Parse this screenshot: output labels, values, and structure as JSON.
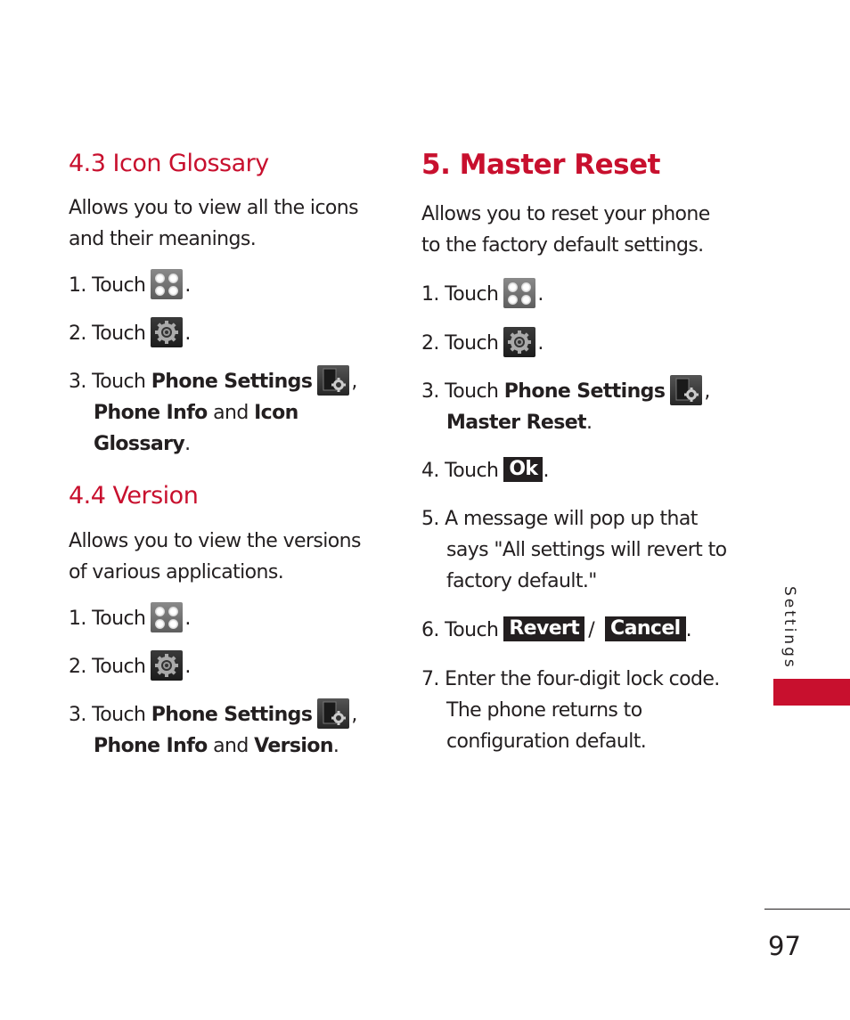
{
  "icon_glossary": {
    "heading": "4.3 Icon Glossary",
    "intro_line1": "Allows you to view all the icons",
    "intro_line2": "and their meanings.",
    "step1": {
      "prefix": "1. Touch",
      "icon": "menu-grid-icon",
      "suffix": "."
    },
    "step2": {
      "prefix": "2. Touch",
      "icon": "gear-icon",
      "suffix": "."
    },
    "step3": {
      "prefix": "3. Touch",
      "bold1": "Phone Settings",
      "icon": "phone-settings-icon",
      "sep1": ",",
      "bold2": "Phone Info",
      "and": "and",
      "bold3a": "Icon",
      "bold3b": "Glossary",
      "end": "."
    }
  },
  "version": {
    "heading": "4.4 Version",
    "intro_line1": "Allows you to view the versions",
    "intro_line2": "of various applications.",
    "step1": {
      "prefix": "1. Touch",
      "suffix": "."
    },
    "step2": {
      "prefix": "2. Touch",
      "suffix": "."
    },
    "step3": {
      "prefix": "3. Touch",
      "bold1": "Phone Settings",
      "sep1": ",",
      "bold2": "Phone Info",
      "and": "and",
      "bold3": "Version",
      "end": "."
    }
  },
  "master_reset": {
    "heading": "5. Master Reset",
    "intro_line1": "Allows you to reset your phone",
    "intro_line2": "to the factory default settings.",
    "step1": {
      "prefix": "1. Touch",
      "suffix": "."
    },
    "step2": {
      "prefix": "2. Touch",
      "suffix": "."
    },
    "step3": {
      "prefix": "3. Touch",
      "bold1": "Phone Settings",
      "sep1": ",",
      "bold2": "Master Reset",
      "end": "."
    },
    "step4": {
      "prefix": "4. Touch",
      "button": "Ok",
      "suffix": "."
    },
    "step5": {
      "line1": "5. A message will pop up that",
      "line2": "says \"All settings will revert to",
      "line3": "factory default.\""
    },
    "step6": {
      "prefix": "6. Touch",
      "button1": "Revert",
      "sep": "/",
      "button2": "Cancel",
      "suffix": "."
    },
    "step7": {
      "line1": "7. Enter the four-digit lock code.",
      "line2": "The phone returns to",
      "line3": "configuration default."
    }
  },
  "side_tab": {
    "label": "Settings",
    "color": "#c8102e"
  },
  "page_number": "97",
  "colors": {
    "heading": "#c8102e",
    "text": "#231f20"
  }
}
